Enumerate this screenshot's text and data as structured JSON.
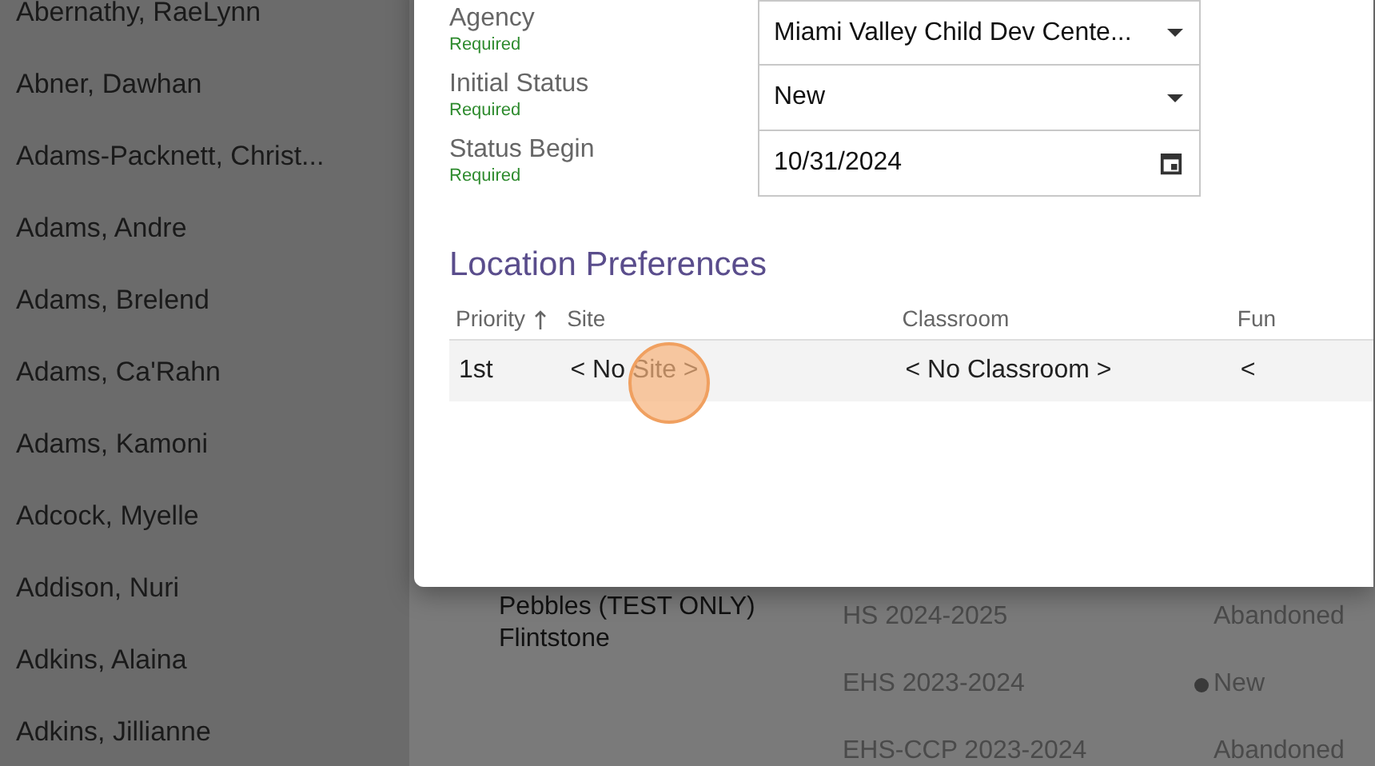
{
  "sidebar": {
    "items": [
      {
        "label": "Abernathy, RaeLynn"
      },
      {
        "label": "Abner, Dawhan"
      },
      {
        "label": "Adams-Packnett, Christ..."
      },
      {
        "label": "Adams, Andre"
      },
      {
        "label": "Adams, Brelend"
      },
      {
        "label": "Adams, Ca'Rahn"
      },
      {
        "label": "Adams, Kamoni"
      },
      {
        "label": "Adcock, Myelle"
      },
      {
        "label": "Addison, Nuri"
      },
      {
        "label": "Adkins, Alaina"
      },
      {
        "label": "Adkins, Jillianne"
      }
    ]
  },
  "background_records": [
    {
      "child": "Pebbles (TEST ONLY) Flintstone",
      "enrollments": [
        {
          "program": "HS 2024-2025",
          "status": "Abandoned",
          "dot": false
        },
        {
          "program": "EHS 2023-2024",
          "status": "New",
          "dot": true
        },
        {
          "program": "EHS-CCP 2023-2024",
          "status": "Abandoned",
          "dot": false
        }
      ]
    }
  ],
  "dialog": {
    "fields": [
      {
        "label": "Agency",
        "hint": "Required",
        "kind": "select",
        "value": "Miami Valley Child Dev Cente..."
      },
      {
        "label": "Initial Status",
        "hint": "Required",
        "kind": "select",
        "value": "New"
      },
      {
        "label": "Status Begin",
        "hint": "Required",
        "kind": "date",
        "value": "10/31/2024"
      }
    ],
    "section_title": "Location Preferences",
    "table": {
      "columns": [
        {
          "label": "Priority",
          "sorted": true
        },
        {
          "label": "Site",
          "sorted": false
        },
        {
          "label": "Classroom",
          "sorted": false
        },
        {
          "label": "Fun",
          "sorted": false
        }
      ],
      "rows": [
        [
          "1st",
          "< No Site >",
          "< No Classroom >",
          "<"
        ]
      ]
    }
  }
}
